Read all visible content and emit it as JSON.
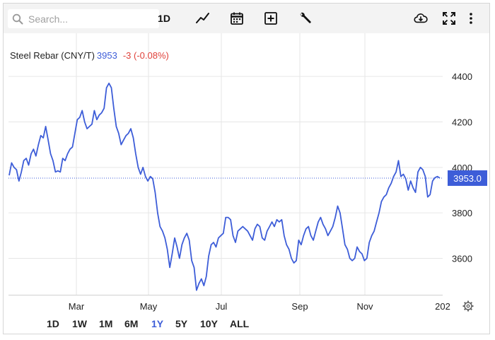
{
  "toolbar": {
    "search_placeholder": "Search...",
    "interval_label": "1D",
    "icons": [
      "search-icon",
      "line-chart-icon",
      "calendar-icon",
      "add-indicator-icon",
      "wrench-icon",
      "download-cloud-icon",
      "fullscreen-icon",
      "more-icon"
    ]
  },
  "legend": {
    "name": "Steel Rebar (CNY/T)",
    "price": "3953",
    "change": "-3 (-0.08%)"
  },
  "colors": {
    "line": "#3d5dd8",
    "negative": "#e0413a",
    "grid": "#e6e6e6",
    "toolbar_bg": "#f3f3f3"
  },
  "chart_data": {
    "type": "line",
    "series": [
      {
        "name": "Steel Rebar (CNY/T)"
      }
    ],
    "x_ticks": [
      "Mar",
      "May",
      "Jul",
      "Sep",
      "Nov",
      "202"
    ],
    "y_ticks": [
      "4400",
      "4200",
      "4000",
      "3800",
      "3600"
    ],
    "ylim": [
      3440,
      4590
    ],
    "last_price_label": "3953.0",
    "last_value": 3953,
    "grid": true,
    "points": [
      [
        0.0,
        3965
      ],
      [
        1.0,
        4020
      ],
      [
        2.0,
        4000
      ],
      [
        3.0,
        3990
      ],
      [
        4.0,
        3940
      ],
      [
        5.0,
        3980
      ],
      [
        6.0,
        4030
      ],
      [
        7.0,
        4040
      ],
      [
        8.0,
        4010
      ],
      [
        9.0,
        4060
      ],
      [
        10.0,
        4080
      ],
      [
        11.0,
        4050
      ],
      [
        12.0,
        4100
      ],
      [
        13.0,
        4140
      ],
      [
        14.0,
        4130
      ],
      [
        15.0,
        4180
      ],
      [
        16.0,
        4120
      ],
      [
        17.0,
        4060
      ],
      [
        18.0,
        4030
      ],
      [
        19.0,
        3980
      ],
      [
        20.0,
        3985
      ],
      [
        21.0,
        3980
      ],
      [
        22.0,
        4040
      ],
      [
        23.0,
        4030
      ],
      [
        24.0,
        4060
      ],
      [
        25.0,
        4080
      ],
      [
        26.0,
        4090
      ],
      [
        27.0,
        4150
      ],
      [
        28.0,
        4210
      ],
      [
        29.0,
        4220
      ],
      [
        30.0,
        4250
      ],
      [
        31.0,
        4200
      ],
      [
        32.0,
        4170
      ],
      [
        33.0,
        4180
      ],
      [
        34.0,
        4190
      ],
      [
        35.0,
        4250
      ],
      [
        36.0,
        4210
      ],
      [
        37.0,
        4230
      ],
      [
        38.0,
        4240
      ],
      [
        39.0,
        4260
      ],
      [
        40.0,
        4350
      ],
      [
        41.0,
        4370
      ],
      [
        42.0,
        4350
      ],
      [
        43.0,
        4260
      ],
      [
        44.0,
        4180
      ],
      [
        45.0,
        4150
      ],
      [
        46.0,
        4100
      ],
      [
        47.0,
        4120
      ],
      [
        48.0,
        4140
      ],
      [
        49.0,
        4150
      ],
      [
        50.0,
        4170
      ],
      [
        51.0,
        4130
      ],
      [
        52.0,
        4060
      ],
      [
        53.0,
        4000
      ],
      [
        54.0,
        3970
      ],
      [
        55.0,
        4000
      ],
      [
        56.0,
        3960
      ],
      [
        57.0,
        3940
      ],
      [
        58.0,
        3960
      ],
      [
        59.0,
        3950
      ],
      [
        60.0,
        3890
      ],
      [
        61.0,
        3800
      ],
      [
        62.0,
        3740
      ],
      [
        63.0,
        3720
      ],
      [
        64.0,
        3690
      ],
      [
        65.0,
        3640
      ],
      [
        66.0,
        3560
      ],
      [
        67.0,
        3620
      ],
      [
        68.0,
        3690
      ],
      [
        69.0,
        3650
      ],
      [
        70.0,
        3600
      ],
      [
        71.0,
        3660
      ],
      [
        72.0,
        3690
      ],
      [
        73.0,
        3710
      ],
      [
        74.0,
        3680
      ],
      [
        75.0,
        3590
      ],
      [
        76.0,
        3560
      ],
      [
        77.0,
        3460
      ],
      [
        78.0,
        3490
      ],
      [
        79.0,
        3510
      ],
      [
        80.0,
        3480
      ],
      [
        81.0,
        3520
      ],
      [
        82.0,
        3610
      ],
      [
        83.0,
        3660
      ],
      [
        84.0,
        3670
      ],
      [
        85.0,
        3650
      ],
      [
        86.0,
        3690
      ],
      [
        87.0,
        3700
      ],
      [
        88.0,
        3710
      ],
      [
        89.0,
        3780
      ],
      [
        90.0,
        3780
      ],
      [
        91.0,
        3770
      ],
      [
        92.0,
        3700
      ],
      [
        93.0,
        3670
      ],
      [
        94.0,
        3720
      ],
      [
        95.0,
        3730
      ],
      [
        96.0,
        3740
      ],
      [
        97.0,
        3730
      ],
      [
        98.0,
        3720
      ],
      [
        99.0,
        3700
      ],
      [
        100.0,
        3680
      ],
      [
        101.0,
        3730
      ],
      [
        102.0,
        3750
      ],
      [
        103.0,
        3740
      ],
      [
        104.0,
        3690
      ],
      [
        105.0,
        3680
      ],
      [
        106.0,
        3720
      ],
      [
        107.0,
        3740
      ],
      [
        108.0,
        3760
      ],
      [
        109.0,
        3740
      ],
      [
        110.0,
        3770
      ],
      [
        111.0,
        3760
      ],
      [
        112.0,
        3770
      ],
      [
        113.0,
        3700
      ],
      [
        114.0,
        3660
      ],
      [
        115.0,
        3640
      ],
      [
        116.0,
        3600
      ],
      [
        117.0,
        3580
      ],
      [
        118.0,
        3590
      ],
      [
        119.0,
        3680
      ],
      [
        120.0,
        3660
      ],
      [
        121.0,
        3700
      ],
      [
        122.0,
        3730
      ],
      [
        123.0,
        3740
      ],
      [
        124.0,
        3700
      ],
      [
        125.0,
        3680
      ],
      [
        126.0,
        3720
      ],
      [
        127.0,
        3760
      ],
      [
        128.0,
        3780
      ],
      [
        129.0,
        3750
      ],
      [
        130.0,
        3730
      ],
      [
        131.0,
        3700
      ],
      [
        132.0,
        3720
      ],
      [
        133.0,
        3740
      ],
      [
        134.0,
        3780
      ],
      [
        135.0,
        3830
      ],
      [
        136.0,
        3800
      ],
      [
        137.0,
        3730
      ],
      [
        138.0,
        3660
      ],
      [
        139.0,
        3640
      ],
      [
        140.0,
        3600
      ],
      [
        141.0,
        3590
      ],
      [
        142.0,
        3600
      ],
      [
        143.0,
        3650
      ],
      [
        144.0,
        3630
      ],
      [
        145.0,
        3620
      ],
      [
        146.0,
        3590
      ],
      [
        147.0,
        3600
      ],
      [
        148.0,
        3670
      ],
      [
        149.0,
        3700
      ],
      [
        150.0,
        3720
      ],
      [
        151.0,
        3760
      ],
      [
        152.0,
        3800
      ],
      [
        153.0,
        3850
      ],
      [
        154.0,
        3870
      ],
      [
        155.0,
        3880
      ],
      [
        156.0,
        3910
      ],
      [
        157.0,
        3930
      ],
      [
        158.0,
        3960
      ],
      [
        159.0,
        3980
      ],
      [
        160.0,
        4030
      ],
      [
        161.0,
        3960
      ],
      [
        162.0,
        3970
      ],
      [
        163.0,
        3950
      ],
      [
        164.0,
        3900
      ],
      [
        165.0,
        3940
      ],
      [
        166.0,
        3910
      ],
      [
        167.0,
        3890
      ],
      [
        168.0,
        3980
      ],
      [
        169.0,
        4000
      ],
      [
        170.0,
        3990
      ],
      [
        171.0,
        3960
      ],
      [
        172.0,
        3870
      ],
      [
        173.0,
        3880
      ],
      [
        174.0,
        3940
      ],
      [
        175.0,
        3955
      ],
      [
        176.0,
        3960
      ],
      [
        177.0,
        3953
      ]
    ]
  },
  "ranges": [
    {
      "label": "1D",
      "active": false
    },
    {
      "label": "1W",
      "active": false
    },
    {
      "label": "1M",
      "active": false
    },
    {
      "label": "6M",
      "active": false
    },
    {
      "label": "1Y",
      "active": true
    },
    {
      "label": "5Y",
      "active": false
    },
    {
      "label": "10Y",
      "active": false
    },
    {
      "label": "ALL",
      "active": false
    }
  ]
}
